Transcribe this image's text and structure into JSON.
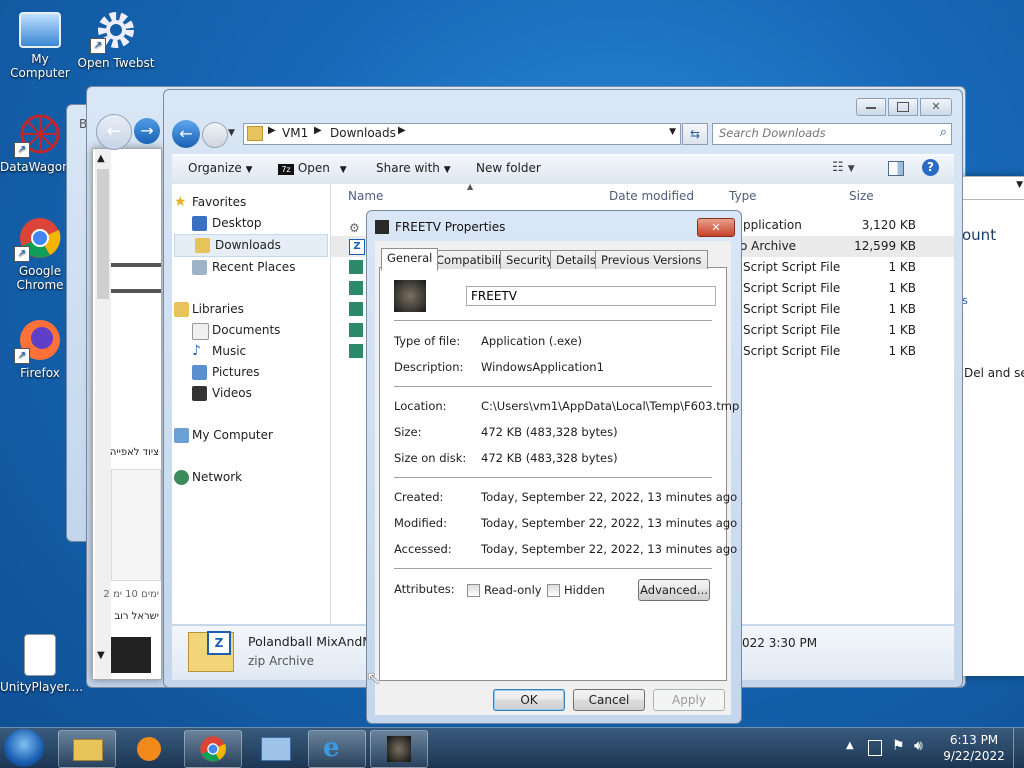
{
  "desktop": {
    "icons": [
      {
        "label": "My Computer"
      },
      {
        "label": "Open Twebst"
      },
      {
        "label": "DataWagon..."
      },
      {
        "label": "Google Chrome"
      },
      {
        "label": "Firefox"
      },
      {
        "label": "UnityPlayer...."
      }
    ]
  },
  "back_window": {
    "b_char": "B",
    "hebrew_items": [
      "ציוד לאפייה",
      "ימים 10 ימ 2",
      "ישראל רוב"
    ],
    "right_text": [
      "ount",
      "s",
      "Del and sele"
    ],
    "bottom_time": "022 3:30 PM"
  },
  "explorer": {
    "breadcrumb": [
      "VM1",
      "Downloads"
    ],
    "search_placeholder": "Search Downloads",
    "toolbar": {
      "organize": "Organize",
      "open": "Open",
      "share": "Share with",
      "new_folder": "New folder"
    },
    "nav": {
      "favorites": "Favorites",
      "fav_items": [
        "Desktop",
        "Downloads",
        "Recent Places"
      ],
      "libraries": "Libraries",
      "lib_items": [
        "Documents",
        "Music",
        "Pictures",
        "Videos"
      ],
      "computer": "My Computer",
      "network": "Network"
    },
    "columns": {
      "name": "Name",
      "date": "Date modified",
      "type": "Type",
      "size": "Size"
    },
    "files": [
      {
        "type": "pplication",
        "size": "3,120 KB"
      },
      {
        "type": "o Archive",
        "size": "12,599 KB"
      },
      {
        "type": "Script Script File",
        "size": "1 KB"
      },
      {
        "type": "Script Script File",
        "size": "1 KB"
      },
      {
        "type": "Script Script File",
        "size": "1 KB"
      },
      {
        "type": "Script Script File",
        "size": "1 KB"
      },
      {
        "type": "Script Script File",
        "size": "1 KB"
      }
    ],
    "details": {
      "name": "Polandball MixAndM",
      "type": "zip Archive"
    }
  },
  "dialog": {
    "title": "FREETV Properties",
    "tabs": [
      "General",
      "Compatibility",
      "Security",
      "Details",
      "Previous Versions"
    ],
    "name_value": "FREETV",
    "type_label": "Type of file:",
    "type_value": "Application (.exe)",
    "desc_label": "Description:",
    "desc_value": "WindowsApplication1",
    "location_label": "Location:",
    "location_value": "C:\\Users\\vm1\\AppData\\Local\\Temp\\F603.tmp",
    "size_label": "Size:",
    "size_value": "472 KB (483,328 bytes)",
    "disk_label": "Size on disk:",
    "disk_value": "472 KB (483,328 bytes)",
    "created_label": "Created:",
    "created_value": "Today, September 22, 2022, 13 minutes ago",
    "modified_label": "Modified:",
    "modified_value": "Today, September 22, 2022, 13 minutes ago",
    "accessed_label": "Accessed:",
    "accessed_value": "Today, September 22, 2022, 13 minutes ago",
    "attributes_label": "Attributes:",
    "readonly": "Read-only",
    "hidden": "Hidden",
    "advanced": "Advanced...",
    "ok": "OK",
    "cancel": "Cancel",
    "apply": "Apply"
  },
  "taskbar": {
    "time": "6:13 PM",
    "date": "9/22/2022"
  }
}
